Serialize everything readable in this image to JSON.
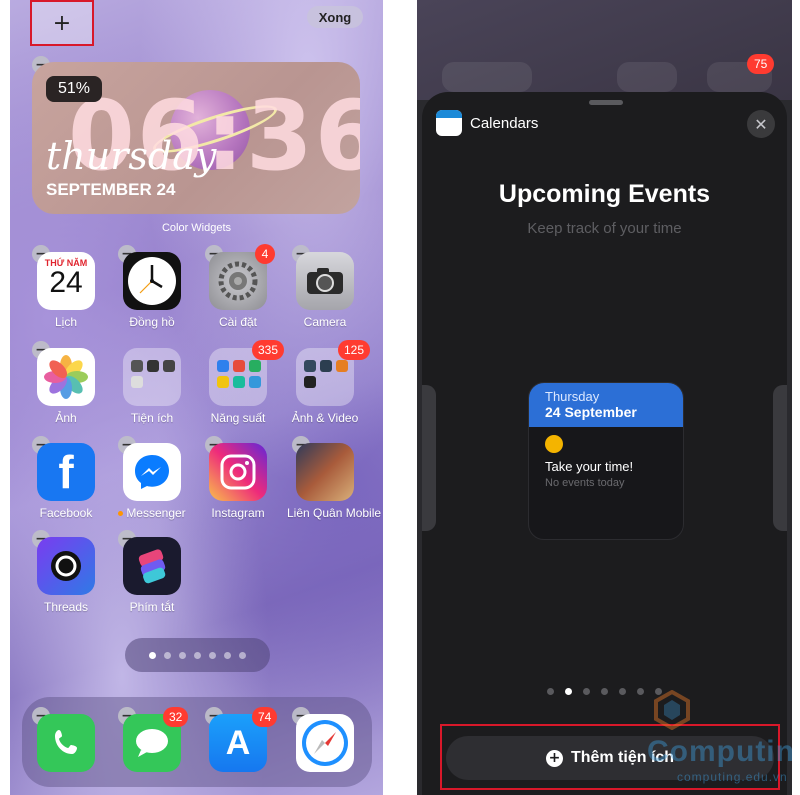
{
  "left_screen": {
    "top_bar": {
      "add_label": "+",
      "done_label": "Xong"
    },
    "widget": {
      "battery": "51%",
      "time": "06:36",
      "weekday": "thursday",
      "date": "SEPTEMBER 24",
      "label": "Color Widgets"
    },
    "apps": [
      {
        "label": "Lịch",
        "icon": "calendar-icon",
        "cal_month": "THỨ NĂM",
        "cal_day": "24"
      },
      {
        "label": "Đồng hồ",
        "icon": "clock-icon"
      },
      {
        "label": "Cài đặt",
        "icon": "settings-icon",
        "badge": "4"
      },
      {
        "label": "Camera",
        "icon": "camera-icon"
      },
      {
        "label": "Ảnh",
        "icon": "photos-icon"
      },
      {
        "label": "Tiện ích",
        "icon": "folder-icon"
      },
      {
        "label": "Năng suất",
        "icon": "folder-icon",
        "badge": "335"
      },
      {
        "label": "Ảnh & Video",
        "icon": "folder-icon",
        "badge": "125"
      },
      {
        "label": "Facebook",
        "icon": "facebook-icon",
        "glyph": "f"
      },
      {
        "label": "Messenger",
        "icon": "messenger-icon"
      },
      {
        "label": "Instagram",
        "icon": "instagram-icon"
      },
      {
        "label": "Liên Quân Mobile",
        "icon": "game-icon"
      },
      {
        "label": "Threads",
        "icon": "threads-icon"
      },
      {
        "label": "Phím tắt",
        "icon": "shortcuts-icon"
      }
    ],
    "dock": [
      {
        "icon": "phone-icon"
      },
      {
        "icon": "messages-icon",
        "badge": "32"
      },
      {
        "icon": "app-store-icon",
        "badge": "74"
      },
      {
        "icon": "safari-icon"
      }
    ]
  },
  "right_screen": {
    "bg_badge": "75",
    "app_name": "Calendars",
    "close_glyph": "✕",
    "title": "Upcoming Events",
    "subtitle": "Keep track of your time",
    "preview": {
      "day": "Thursday",
      "date": "24 September",
      "message": "Take your time!",
      "empty": "No events today"
    },
    "add_button": {
      "label": "Thêm tiện ích",
      "glyph": "+"
    },
    "watermark": {
      "brand": "Computing",
      "url": "computing.edu.vn"
    }
  },
  "colors": {
    "highlight": "#d8182a",
    "badge": "#ff3b30",
    "accent_blue": "#2c6fd6"
  }
}
